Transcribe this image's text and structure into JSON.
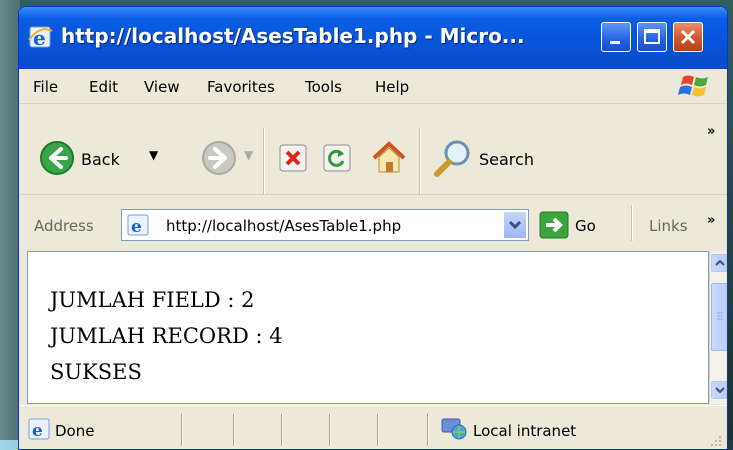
{
  "window": {
    "title": "http://localhost/AsesTable1.php - Micro..."
  },
  "menu": [
    "File",
    "Edit",
    "View",
    "Favorites",
    "Tools",
    "Help"
  ],
  "toolbar": {
    "back_label": "Back",
    "search_label": "Search",
    "overflow": "»"
  },
  "address": {
    "label": "Address",
    "url": "http://localhost/AsesTable1.php",
    "go_label": "Go",
    "links_label": "Links",
    "overflow": "»"
  },
  "page": {
    "lines": [
      "JUMLAH FIELD : 2",
      "JUMLAH RECORD : 4",
      "SUKSES"
    ]
  },
  "status": {
    "text": "Done",
    "zone": "Local intranet"
  },
  "colors": {
    "titlebar": "#0753d9",
    "close_button": "#d3532c",
    "chrome": "#ece9d8"
  }
}
